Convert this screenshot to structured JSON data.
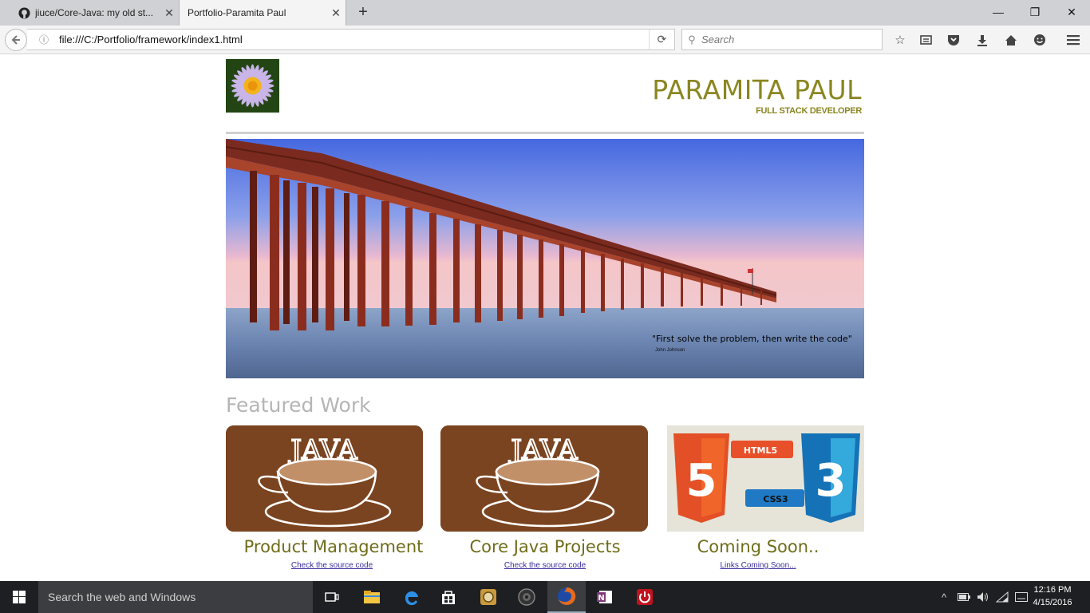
{
  "browser": {
    "tabs": [
      {
        "title": "jiuce/Core-Java: my old st...",
        "icon": "github-icon",
        "active": false
      },
      {
        "title": "Portfolio-Paramita Paul",
        "active": true
      }
    ],
    "url": "file:///C:/Portfolio/framework/index1.html",
    "search_placeholder": "Search"
  },
  "page": {
    "brand_name": "PARAMITA PAUL",
    "brand_subtitle": "FULL STACK DEVELOPER",
    "quote": "\"First solve the problem, then write the code\"",
    "quote_author": "John Johnson",
    "featured_title": "Featured Work",
    "cards": [
      {
        "title": "Product Management",
        "link": "Check the source code",
        "image": "java-coffee-logo"
      },
      {
        "title": "Core Java Projects",
        "link": "Check the source code",
        "image": "java-coffee-logo"
      },
      {
        "title": "Coming Soon..",
        "link": "Links Coming Soon...",
        "image": "html5-css3-logo"
      }
    ],
    "html5_label": "HTML5",
    "css3_label": "CSS3",
    "html5_digit": "5",
    "css3_digit": "3",
    "java_word": "JAVA"
  },
  "taskbar": {
    "search_placeholder": "Search the web and Windows",
    "time": "12:16 PM",
    "date": "4/15/2016"
  },
  "colors": {
    "brand": "#8a8620",
    "card_title": "#6f6d1a",
    "java_brown": "#7b4420",
    "link": "#3b2ea1"
  }
}
